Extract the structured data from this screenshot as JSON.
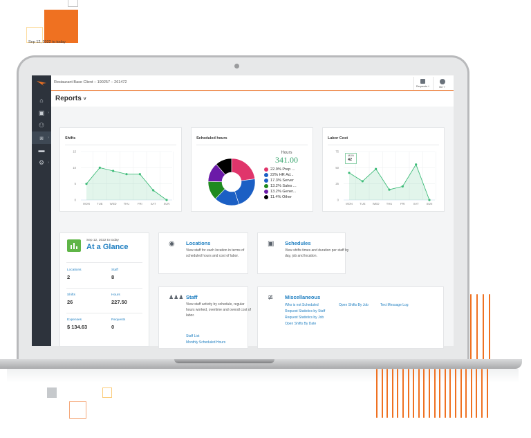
{
  "app": {
    "client_name": "Restaurant Base Client – 190257 – 261472",
    "requests_label": "Requests ˅",
    "me_label": "Me ˅",
    "page_title": "Reports",
    "page_title_caret": "˅",
    "date_range": "Sep 12, 2022 to today"
  },
  "sidebar": {
    "items": [
      {
        "name": "home",
        "icon": "⌂",
        "active": false
      },
      {
        "name": "schedule",
        "icon": "▣",
        "active": false,
        "has_submenu": true
      },
      {
        "name": "staff",
        "icon": "⚇",
        "active": false
      },
      {
        "name": "reports",
        "icon": "⩏",
        "active": true,
        "has_submenu": true
      },
      {
        "name": "messages",
        "icon": "▬",
        "active": false
      },
      {
        "name": "settings",
        "icon": "⚙",
        "active": false,
        "has_submenu": true
      }
    ]
  },
  "cards": {
    "shifts_title": "Shifts",
    "scheduled_title": "Scheduled hours",
    "labor_title": "Labor Cost",
    "hours_label": "Hours",
    "hours_total": "341.00",
    "legend": [
      {
        "label": "22.9% Prep ...",
        "color": "#e0356b"
      },
      {
        "label": "22% HR Ad...",
        "color": "#1b5fc4"
      },
      {
        "label": "17.3% Server",
        "color": "#1b5fc4"
      },
      {
        "label": "13.2% Sales ...",
        "color": "#1f8a1f"
      },
      {
        "label": "13.2% Gener...",
        "color": "#6b1aa8"
      },
      {
        "label": "11.4% Other",
        "color": "#000000"
      }
    ],
    "tooltip": {
      "day": "MON",
      "value": "42"
    }
  },
  "chart_data": [
    {
      "type": "area",
      "title": "Shifts",
      "categories": [
        "MON",
        "TUE",
        "WED",
        "THU",
        "FRI",
        "SAT",
        "SUN"
      ],
      "values": [
        5,
        10,
        9,
        8,
        8,
        3,
        0
      ],
      "ylim": [
        0,
        15
      ],
      "yticks": [
        0,
        5,
        10,
        15
      ],
      "color": "#3dbb78",
      "grid": true
    },
    {
      "type": "pie",
      "title": "Scheduled hours",
      "center_label": "Hours",
      "center_value": 341.0,
      "labels": [
        "Prep ...",
        "HR Ad...",
        "Server",
        "Sales ...",
        "Gener...",
        "Other"
      ],
      "values": [
        22.9,
        22,
        17.3,
        13.2,
        13.2,
        11.4
      ],
      "colors": [
        "#e0356b",
        "#1b5fc4",
        "#1b5fc4",
        "#1f8a1f",
        "#6b1aa8",
        "#000000"
      ],
      "donut": true,
      "legend": "right"
    },
    {
      "type": "area",
      "title": "Labor Cost",
      "categories": [
        "MON",
        "TUE",
        "WED",
        "THU",
        "FRI",
        "SAT",
        "SUN"
      ],
      "values": [
        42,
        29,
        48,
        16,
        21,
        55,
        0
      ],
      "ylim": [
        0,
        75
      ],
      "yticks": [
        0,
        25,
        50,
        75
      ],
      "color": "#3dbb78",
      "grid": true
    }
  ],
  "glance": {
    "date": "Sep 12, 2022 to today",
    "title": "At a Glance",
    "stats": [
      {
        "label": "Locations",
        "value": "2"
      },
      {
        "label": "Staff",
        "value": "8"
      },
      {
        "label": "Shifts",
        "value": "26"
      },
      {
        "label": "Hours",
        "value": "227.50"
      },
      {
        "label": "Expenses",
        "value": "$ 134.63"
      },
      {
        "label": "Requests",
        "value": "0"
      }
    ]
  },
  "tiles": {
    "locations": {
      "title": "Locations",
      "desc": "View staff for each location in terms of scheduled hours and cost of labor."
    },
    "schedules": {
      "title": "Schedules",
      "desc": "View shifts times and duration per staff by day, job and location."
    },
    "staff": {
      "title": "Staff",
      "desc": "View staff activity by schedule, regular hours worked, overtime and overall cost of labor.",
      "links": [
        "Staff List",
        "Monthly Scheduled Hours"
      ]
    },
    "misc": {
      "title": "Miscellaneous",
      "links": [
        "Who is not Scheduled",
        "Request Statistics by Staff",
        "Request Statistics by Job",
        "Open Shifts By Date",
        "Open Shifts By Job",
        "Text Message Log"
      ]
    }
  }
}
